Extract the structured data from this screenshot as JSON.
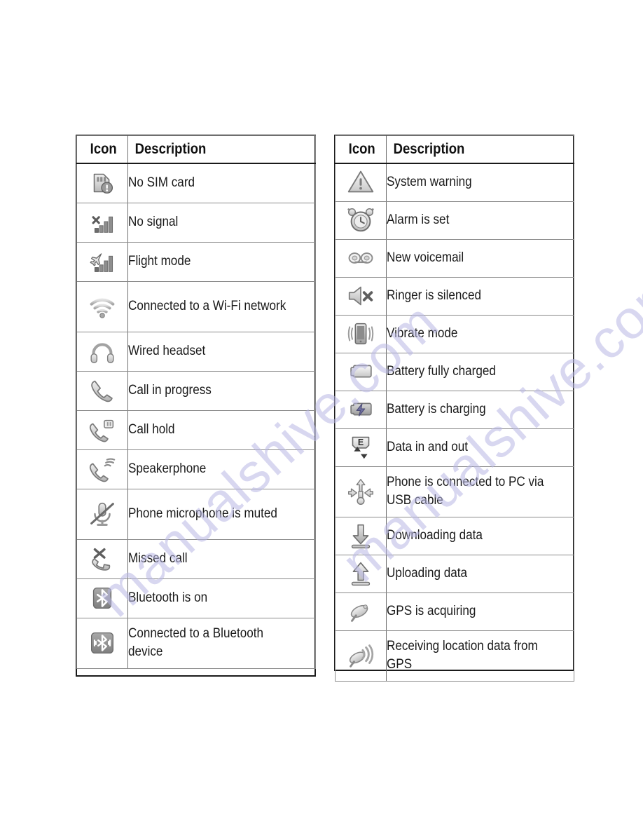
{
  "document": {
    "page_kind": "status-bar-icon-reference-tables",
    "watermark_text": "manualshive.com",
    "watermark_color": "#b9b8e4",
    "border_color": "#1a1a1a",
    "grid_line_color": "#8a8a8a",
    "text_color": "#1a1a1a"
  },
  "tables": [
    {
      "id": "left",
      "headers": {
        "icon": "Icon",
        "description": "Description"
      },
      "rows": [
        {
          "icon_name": "no-sim-card-icon",
          "description": "No SIM card"
        },
        {
          "icon_name": "no-signal-icon",
          "description": "No signal"
        },
        {
          "icon_name": "flight-mode-icon",
          "description": "Flight mode"
        },
        {
          "icon_name": "wifi-connected-icon",
          "description": "Connected to a Wi-Fi network"
        },
        {
          "icon_name": "wired-headset-icon",
          "description": "Wired headset"
        },
        {
          "icon_name": "call-in-progress-icon",
          "description": "Call in progress"
        },
        {
          "icon_name": "call-hold-icon",
          "description": "Call hold"
        },
        {
          "icon_name": "speakerphone-icon",
          "description": "Speakerphone"
        },
        {
          "icon_name": "microphone-muted-icon",
          "description": "Phone microphone is muted"
        },
        {
          "icon_name": "missed-call-icon",
          "description": "Missed call"
        },
        {
          "icon_name": "bluetooth-on-icon",
          "description": "Bluetooth is on"
        },
        {
          "icon_name": "bluetooth-connected-icon",
          "description": "Connected to a Bluetooth device"
        }
      ]
    },
    {
      "id": "right",
      "headers": {
        "icon": "Icon",
        "description": "Description"
      },
      "rows": [
        {
          "icon_name": "system-warning-icon",
          "description": "System warning"
        },
        {
          "icon_name": "alarm-set-icon",
          "description": "Alarm is set"
        },
        {
          "icon_name": "new-voicemail-icon",
          "description": "New voicemail"
        },
        {
          "icon_name": "ringer-silenced-icon",
          "description": "Ringer is silenced"
        },
        {
          "icon_name": "vibrate-mode-icon",
          "description": "Vibrate mode"
        },
        {
          "icon_name": "battery-full-icon",
          "description": "Battery fully charged"
        },
        {
          "icon_name": "battery-charging-icon",
          "description": "Battery is charging"
        },
        {
          "icon_name": "data-in-and-out-icon",
          "description": "Data in and out"
        },
        {
          "icon_name": "usb-connected-icon",
          "description": "Phone is connected to PC via USB cable"
        },
        {
          "icon_name": "downloading-data-icon",
          "description": "Downloading data"
        },
        {
          "icon_name": "uploading-data-icon",
          "description": "Uploading data"
        },
        {
          "icon_name": "gps-acquiring-icon",
          "description": "GPS is acquiring"
        },
        {
          "icon_name": "gps-receiving-icon",
          "description": "Receiving location data from GPS"
        }
      ]
    }
  ]
}
